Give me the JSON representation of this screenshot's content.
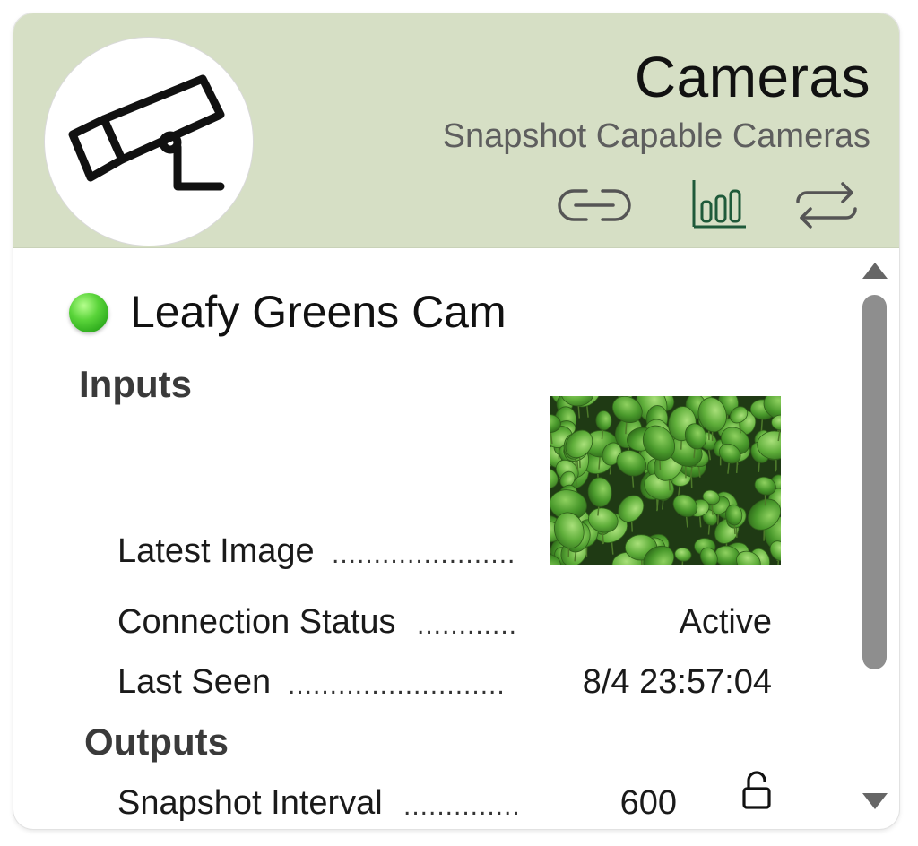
{
  "header": {
    "title": "Cameras",
    "subtitle": "Snapshot Capable Cameras",
    "icons": [
      "link-icon",
      "bar-chart-icon",
      "sync-icon"
    ],
    "background": "#d6dfc5",
    "active_icon_color": "#1f5a3a"
  },
  "avatar": {
    "icon": "security-camera-icon"
  },
  "device": {
    "name": "Leafy Greens Cam",
    "status_color": "#3cc42a"
  },
  "inputs": {
    "heading": "Inputs",
    "rows": [
      {
        "label": "Latest Image",
        "dots": "......................",
        "value": ""
      },
      {
        "label": "Connection Status",
        "dots": "............",
        "value": "Active"
      },
      {
        "label": "Last Seen",
        "dots": "..........................",
        "value": "8/4 23:57:04"
      }
    ]
  },
  "outputs": {
    "heading": "Outputs",
    "rows": [
      {
        "label": "Snapshot Interval",
        "dots": "..............",
        "value": "600",
        "icon": "unlock-icon"
      }
    ]
  }
}
